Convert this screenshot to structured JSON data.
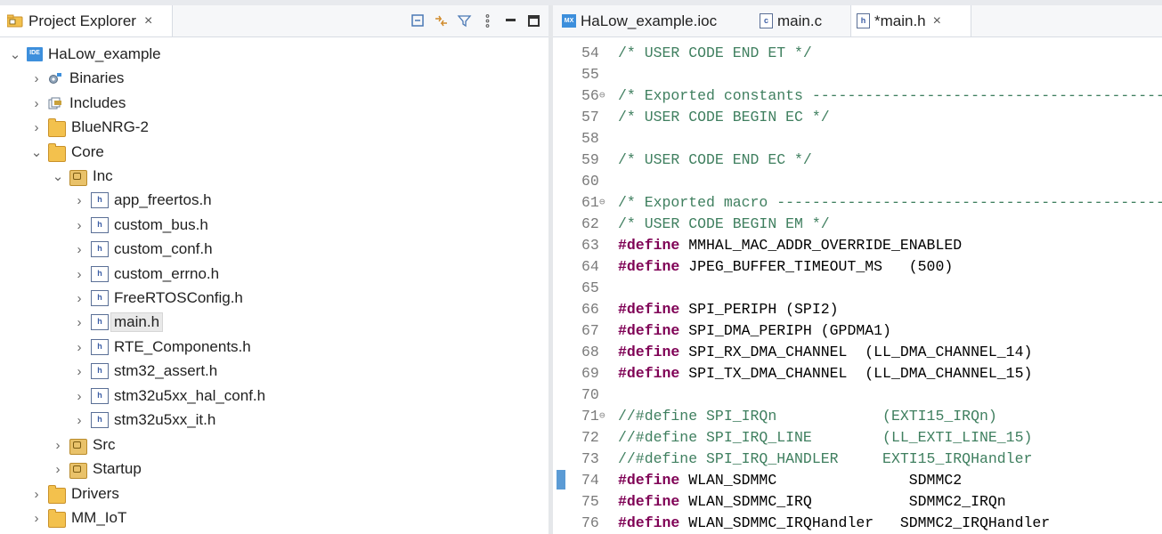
{
  "explorer": {
    "tab_label": "Project Explorer",
    "tab_close": "×",
    "tree": [
      {
        "label": "HaLow_example",
        "icon": "project-icon",
        "arrow": "⌄",
        "depth": 0
      },
      {
        "label": "Binaries",
        "icon": "binaries-icon",
        "arrow": "›",
        "depth": 1
      },
      {
        "label": "Includes",
        "icon": "includes-icon",
        "arrow": "›",
        "depth": 1
      },
      {
        "label": "BlueNRG-2",
        "icon": "folder-icon",
        "arrow": "›",
        "depth": 1
      },
      {
        "label": "Core",
        "icon": "folder-icon",
        "arrow": "⌄",
        "depth": 1
      },
      {
        "label": "Inc",
        "icon": "source-folder-icon",
        "arrow": "⌄",
        "depth": 2
      },
      {
        "label": "app_freertos.h",
        "icon": "header-file-icon",
        "arrow": "›",
        "depth": 3
      },
      {
        "label": "custom_bus.h",
        "icon": "header-file-icon",
        "arrow": "›",
        "depth": 3
      },
      {
        "label": "custom_conf.h",
        "icon": "header-file-icon",
        "arrow": "›",
        "depth": 3
      },
      {
        "label": "custom_errno.h",
        "icon": "header-file-icon",
        "arrow": "›",
        "depth": 3
      },
      {
        "label": "FreeRTOSConfig.h",
        "icon": "header-file-icon",
        "arrow": "›",
        "depth": 3
      },
      {
        "label": "main.h",
        "icon": "header-file-icon",
        "arrow": "›",
        "depth": 3,
        "selected": true
      },
      {
        "label": "RTE_Components.h",
        "icon": "header-file-icon",
        "arrow": "›",
        "depth": 3
      },
      {
        "label": "stm32_assert.h",
        "icon": "header-file-icon",
        "arrow": "›",
        "depth": 3
      },
      {
        "label": "stm32u5xx_hal_conf.h",
        "icon": "header-file-icon",
        "arrow": "›",
        "depth": 3
      },
      {
        "label": "stm32u5xx_it.h",
        "icon": "header-file-icon",
        "arrow": "›",
        "depth": 3
      },
      {
        "label": "Src",
        "icon": "source-folder-icon",
        "arrow": "›",
        "depth": 2
      },
      {
        "label": "Startup",
        "icon": "source-folder-icon",
        "arrow": "›",
        "depth": 2
      },
      {
        "label": "Drivers",
        "icon": "folder-icon",
        "arrow": "›",
        "depth": 1
      },
      {
        "label": "MM_IoT",
        "icon": "folder-icon",
        "arrow": "›",
        "depth": 1
      }
    ]
  },
  "editor": {
    "tabs": [
      {
        "label": "HaLow_example.ioc",
        "icon": "ioc-file-icon",
        "icon_text": "MX"
      },
      {
        "label": "main.c",
        "icon": "c-file-icon",
        "icon_text": "c"
      },
      {
        "label": "*main.h",
        "icon": "header-file-icon",
        "icon_text": "h",
        "active": true,
        "close": "×"
      }
    ],
    "lines": [
      {
        "n": "54",
        "tokens": [
          {
            "t": "/* USER CODE END ET */",
            "c": "cm"
          }
        ]
      },
      {
        "n": "55",
        "tokens": []
      },
      {
        "n": "56",
        "fold": "⊖",
        "tokens": [
          {
            "t": "/* Exported constants --------------------------------------------",
            "c": "cm"
          }
        ]
      },
      {
        "n": "57",
        "tokens": [
          {
            "t": "/* USER CODE BEGIN EC */",
            "c": "cm"
          }
        ]
      },
      {
        "n": "58",
        "tokens": []
      },
      {
        "n": "59",
        "tokens": [
          {
            "t": "/* USER CODE END EC */",
            "c": "cm"
          }
        ]
      },
      {
        "n": "60",
        "tokens": []
      },
      {
        "n": "61",
        "fold": "⊖",
        "tokens": [
          {
            "t": "/* Exported macro --------------------------------------------------",
            "c": "cm"
          }
        ]
      },
      {
        "n": "62",
        "tokens": [
          {
            "t": "/* USER CODE BEGIN EM */",
            "c": "cm"
          }
        ]
      },
      {
        "n": "63",
        "tokens": [
          {
            "t": "#define",
            "c": "kw"
          },
          {
            "t": " MMHAL_MAC_ADDR_OVERRIDE_ENABLED",
            "c": "id"
          }
        ]
      },
      {
        "n": "64",
        "tokens": [
          {
            "t": "#define",
            "c": "kw"
          },
          {
            "t": " JPEG_BUFFER_TIMEOUT_MS   (500)",
            "c": "id"
          }
        ]
      },
      {
        "n": "65",
        "tokens": []
      },
      {
        "n": "66",
        "tokens": [
          {
            "t": "#define",
            "c": "kw"
          },
          {
            "t": " SPI_PERIPH (SPI2)",
            "c": "id"
          }
        ]
      },
      {
        "n": "67",
        "tokens": [
          {
            "t": "#define",
            "c": "kw"
          },
          {
            "t": " SPI_DMA_PERIPH (GPDMA1)",
            "c": "id"
          }
        ]
      },
      {
        "n": "68",
        "tokens": [
          {
            "t": "#define",
            "c": "kw"
          },
          {
            "t": " SPI_RX_DMA_CHANNEL  (LL_DMA_CHANNEL_14)",
            "c": "id"
          }
        ]
      },
      {
        "n": "69",
        "tokens": [
          {
            "t": "#define",
            "c": "kw"
          },
          {
            "t": " SPI_TX_DMA_CHANNEL  (LL_DMA_CHANNEL_15)",
            "c": "id"
          }
        ]
      },
      {
        "n": "70",
        "tokens": []
      },
      {
        "n": "71",
        "fold": "⊖",
        "tokens": [
          {
            "t": "//#define SPI_IRQn            (EXTI15_IRQn)",
            "c": "cm"
          }
        ]
      },
      {
        "n": "72",
        "tokens": [
          {
            "t": "//#define SPI_IRQ_LINE        (LL_EXTI_LINE_15)",
            "c": "cm"
          }
        ]
      },
      {
        "n": "73",
        "tokens": [
          {
            "t": "//#define SPI_IRQ_HANDLER     EXTI15_IRQHandler",
            "c": "cm"
          }
        ]
      },
      {
        "n": "74",
        "marker": true,
        "tokens": [
          {
            "t": "#define",
            "c": "kw"
          },
          {
            "t": " WLAN_SDMMC               SDMMC2",
            "c": "id"
          }
        ]
      },
      {
        "n": "75",
        "tokens": [
          {
            "t": "#define",
            "c": "kw"
          },
          {
            "t": " WLAN_SDMMC_IRQ           SDMMC2_IRQn",
            "c": "id"
          }
        ]
      },
      {
        "n": "76",
        "tokens": [
          {
            "t": "#define",
            "c": "kw"
          },
          {
            "t": " WLAN_SDMMC_IRQHandler   SDMMC2_IRQHandler",
            "c": "id"
          }
        ]
      }
    ]
  },
  "colors": {
    "comment": "#3f7f5f",
    "keyword": "#7f0055",
    "selection": "#e9e9e9",
    "marker": "#5b9bd5"
  }
}
